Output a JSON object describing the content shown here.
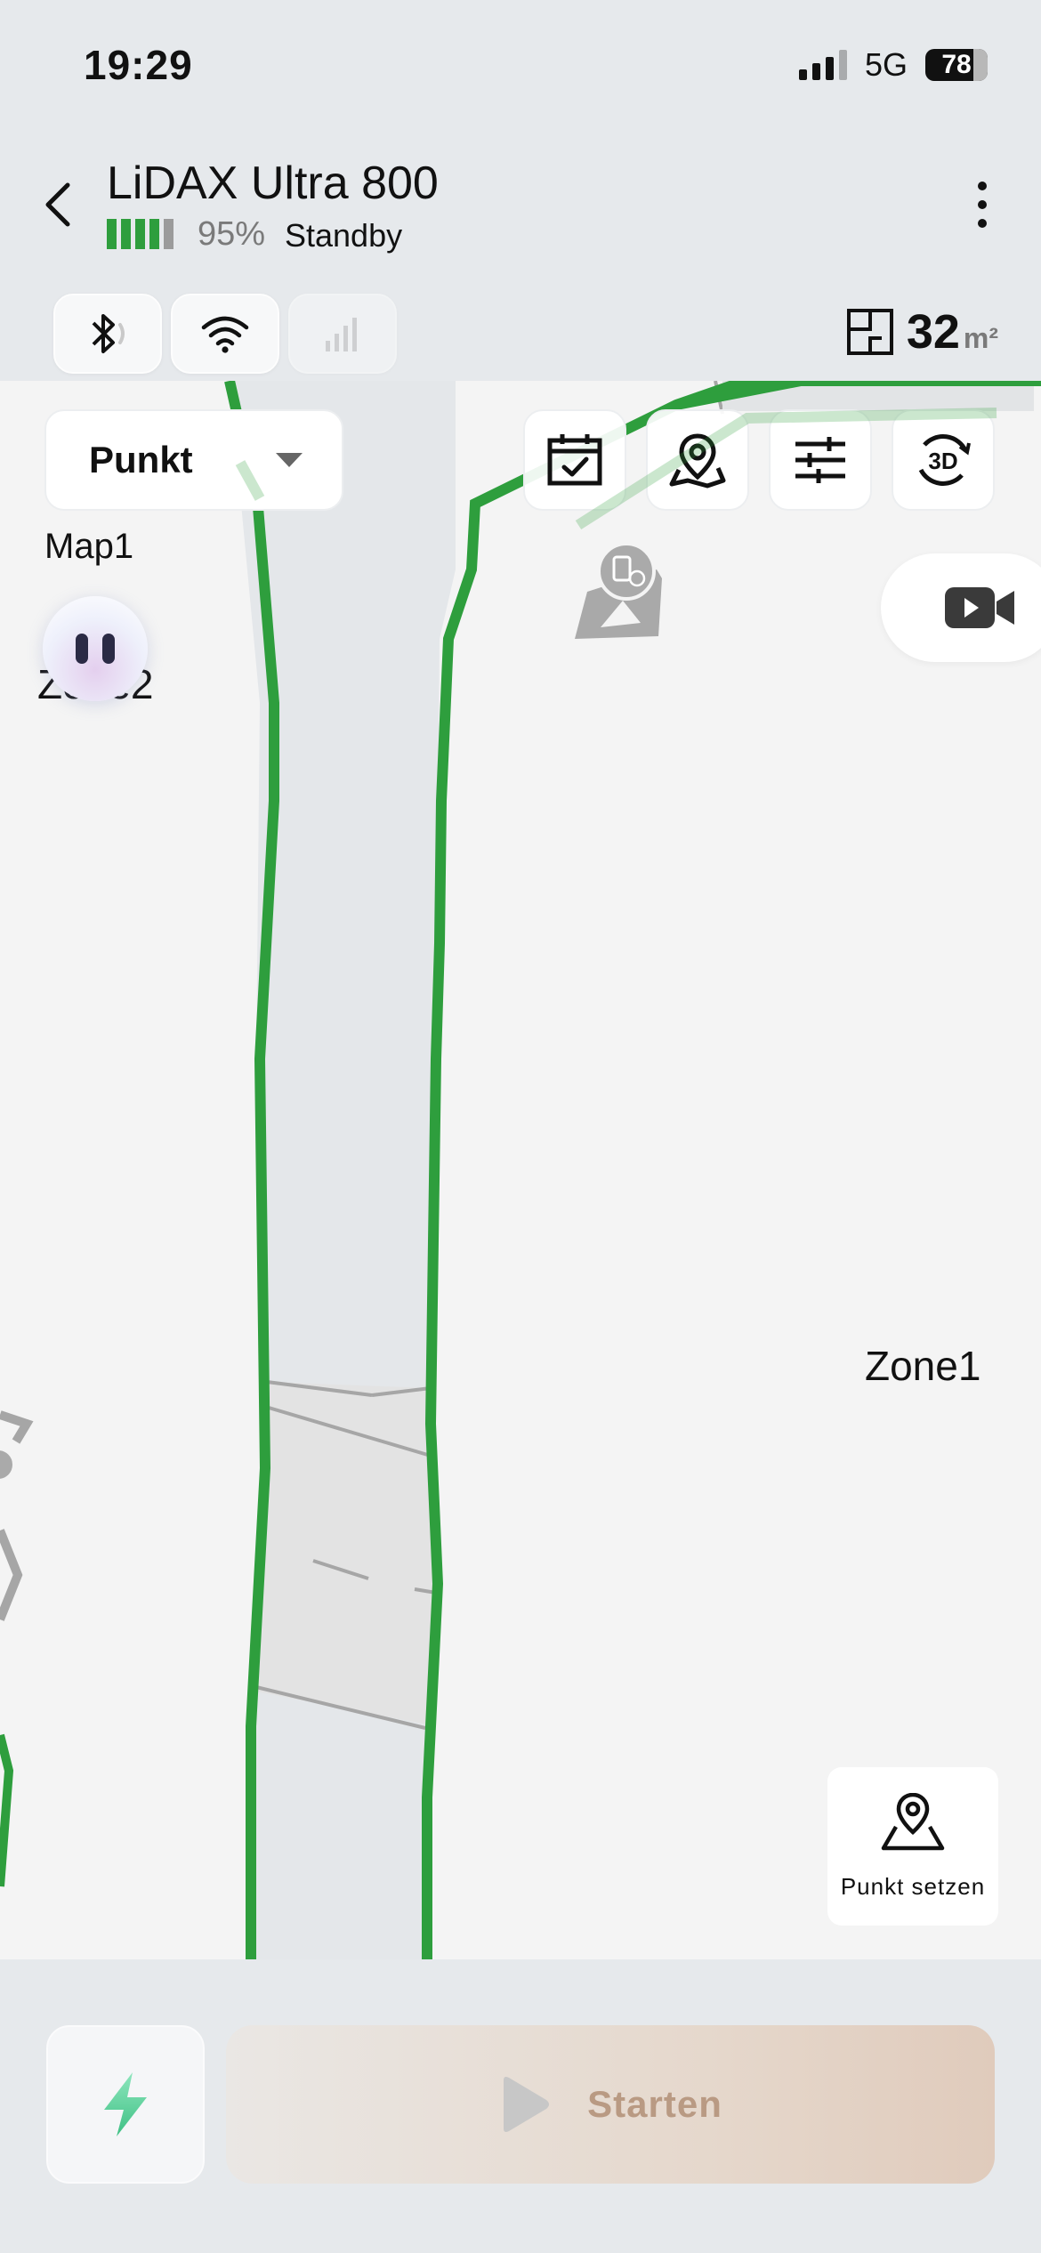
{
  "status_bar": {
    "time": "19:29",
    "network": "5G",
    "battery": "78"
  },
  "header": {
    "title": "LiDAX Ultra 800",
    "battery_percent": "95%",
    "state": "Standby",
    "battery_level": 0.95
  },
  "connectivity": {
    "bluetooth_icon": "bluetooth-icon",
    "wifi_icon": "wifi-icon",
    "cellular_icon": "cellular-signal-icon"
  },
  "area": {
    "value": "32",
    "unit": "m²"
  },
  "map_controls": {
    "mode": "Punkt",
    "tools": [
      "calendar-check-icon",
      "map-pin-icon",
      "sliders-icon",
      "3d-view-icon"
    ]
  },
  "map": {
    "map_name": "Map1",
    "zones": [
      "Zone1",
      "Zone2"
    ]
  },
  "set_point": {
    "label": "Punkt setzen"
  },
  "actions": {
    "start_label": "Starten"
  },
  "colors": {
    "boundary": "#2e9e3d",
    "accent_charge": "#5cd39a",
    "start_text": "#b99a83"
  }
}
